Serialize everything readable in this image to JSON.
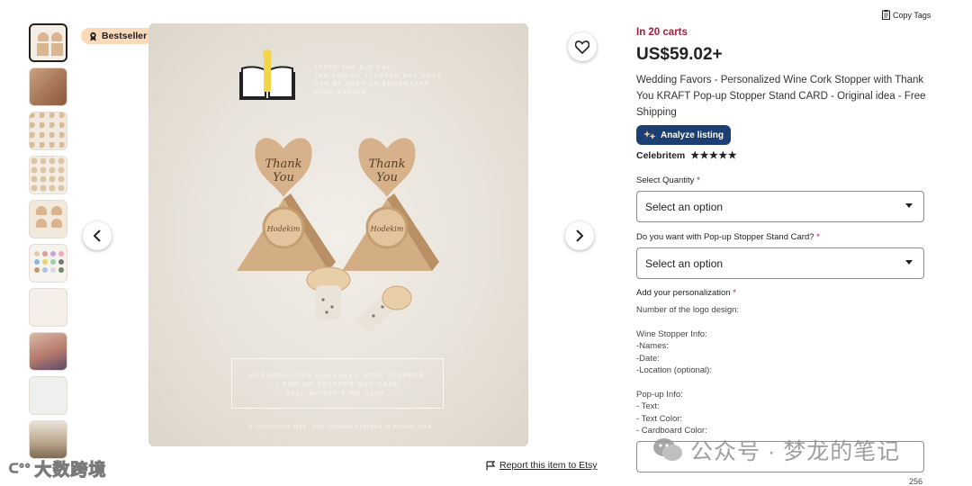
{
  "gallery": {
    "thumbnail_count": 10,
    "bestseller_label": "Bestseller",
    "image_text": {
      "book_caption_lines": [
        "AFTER THE BIG DAY,",
        "THE POP-UP STOPPER BOX CARD",
        "CAN BE USED AS BOOKMARKS",
        "DIWII DESIGN"
      ],
      "card_text": "Thank You",
      "stopper_text": "Hodekim",
      "banner_lines": [
        "PERSONALIZED ENGRAVED WINE STOPPER",
        "+ POP-UP STOPPER BOX CARD",
        "SELF-MOUNT & NO GLUE."
      ],
      "copyright": "© COPYRIGHT 2024 · POP-UP WINE STOPPER IS PATENT IDEA"
    },
    "report_link": "Report this item to Etsy"
  },
  "listing": {
    "copy_tags": "Copy Tags",
    "in_carts": "In 20 carts",
    "price": "US$59.02+",
    "title": "Wedding Favors - Personalized Wine Cork Stopper with Thank You KRAFT Pop-up Stopper Stand CARD - Original idea - Free Shipping",
    "analyze_label": "Analyze listing",
    "shop_name": "Celebritem",
    "stars": "★★★★★"
  },
  "form": {
    "quantity_label": "Select Quantity",
    "quantity_value": "Select an option",
    "popup_label": "Do you want with Pop-up Stopper Stand Card?",
    "popup_value": "Select an option",
    "personalization_label": "Add your personalization",
    "required_mark": "*",
    "instructions": "Number of the logo design:\n\nWine Stopper Info:\n-Names:\n-Date:\n-Location (optional):\n\nPop-up Info:\n- Text:\n- Text Color:\n- Cardboard Color:",
    "char_counter": "256"
  },
  "watermarks": {
    "left": "大数跨境",
    "right": "公众号 · 梦龙的笔记"
  },
  "colors": {
    "accent_red": "#b3173b",
    "analyze_bg": "#1b3f73",
    "bestseller_bg": "#fcd9b8"
  }
}
